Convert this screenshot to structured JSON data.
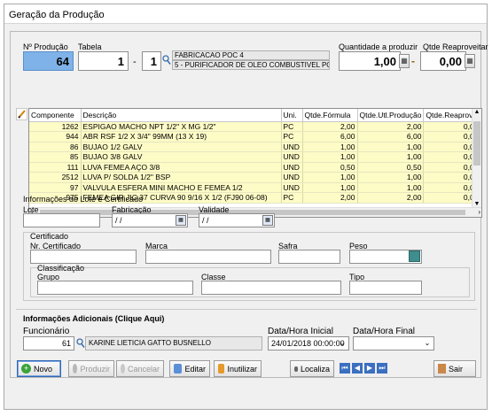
{
  "window": {
    "title": "Geração da Produção"
  },
  "header": {
    "nproducao_label": "Nº Produção",
    "nproducao_value": "64",
    "tabela_label": "Tabela",
    "tabela_value1": "1",
    "tabela_sep": "-",
    "tabela_value2": "1",
    "tabela_desc1": "FABRICACAO POC 4",
    "tabela_desc2": "5 - PURIFICADOR DE OLEO COMBUSTIVEL POC 4 UN",
    "qtd_produzir_label": "Quantidade a produzir",
    "qtd_produzir_value": "1,00",
    "qtd_reaprov_label": "Qtde Reaproveitar",
    "qtd_reaprov_value": "0,00",
    "minus_sign": "-"
  },
  "grid": {
    "columns": [
      "Componente",
      "Descrição",
      "Uni.",
      "Qtde.Fórmula",
      "Qtde.Utl.Produção",
      "Qtde.Reaprov."
    ],
    "rows": [
      {
        "comp": "1262",
        "desc": "ESPIGAO MACHO NPT 1/2\" X MG 1/2\"",
        "uni": "PC",
        "qf": "2,00",
        "qu": "2,00",
        "qr": "0,00"
      },
      {
        "comp": "944",
        "desc": "ABR RSF 1/2 X 3/4\" 99MM (13 X 19)",
        "uni": "PC",
        "qf": "6,00",
        "qu": "6,00",
        "qr": "0,00"
      },
      {
        "comp": "86",
        "desc": "BUJAO 1/2 GALV",
        "uni": "UND",
        "qf": "1,00",
        "qu": "1,00",
        "qr": "0,00"
      },
      {
        "comp": "85",
        "desc": "BUJAO 3/8 GALV",
        "uni": "UND",
        "qf": "1,00",
        "qu": "1,00",
        "qr": "0,00"
      },
      {
        "comp": "111",
        "desc": "LUVA FEMEA AÇO 3/8",
        "uni": "UND",
        "qf": "0,50",
        "qu": "0,50",
        "qr": "0,00"
      },
      {
        "comp": "2512",
        "desc": "LUVA P/ SOLDA 1/2\" BSP",
        "uni": "UND",
        "qf": "1,00",
        "qu": "1,00",
        "qr": "0,00"
      },
      {
        "comp": "97",
        "desc": "VALVULA ESFERA MINI MACHO E FEMEA 1/2",
        "uni": "UND",
        "qf": "1,00",
        "qu": "1,00",
        "qr": "0,00"
      },
      {
        "comp": "975",
        "desc": "FEMEA GIR JIC 37 CURVA 90 9/16 X 1/2 (FJ90 06-08)",
        "uni": "PC",
        "qf": "2,00",
        "qu": "2,00",
        "qr": "0,00"
      }
    ]
  },
  "lote": {
    "section_title": "Informações do Lote e Certificado",
    "lote_label": "Lote",
    "fabricacao_label": "Fabricação",
    "fabricacao_value": "/ /",
    "validade_label": "Validade",
    "validade_value": "/ /",
    "certificado_title": "Certificado",
    "nr_cert_label": "Nr. Certificado",
    "marca_label": "Marca",
    "safra_label": "Safra",
    "peso_label": "Peso",
    "classificacao_title": "Classificação",
    "grupo_label": "Grupo",
    "classe_label": "Classe",
    "tipo_label": "Tipo"
  },
  "adicionais": {
    "title": "Informações Adicionais (Clique Aqui)",
    "funcionario_label": "Funcionário",
    "funcionario_value": "61",
    "funcionario_name": "KARINE LIETICIA GATTO BUSNELLO",
    "data_inicial_label": "Data/Hora Inicial",
    "data_inicial_value": "24/01/2018 00:00:00",
    "data_final_label": "Data/Hora Final"
  },
  "toolbar": {
    "novo": "Novo",
    "produzir": "Produzir",
    "cancelar": "Cancelar",
    "editar": "Editar",
    "inutilizar": "Inutilizar",
    "localiza": "Localiza",
    "sair": "Sair"
  },
  "colors": {
    "selected_field": "#7fb2e8",
    "grid_row": "#fdfbc6"
  },
  "icons": [
    "search-icon",
    "calculator-icon",
    "calendar-icon",
    "edit-pencil-icon",
    "add-icon",
    "check-icon",
    "cancel-icon",
    "flashlight-icon",
    "first-icon",
    "prev-icon",
    "next-icon",
    "last-icon",
    "exit-icon"
  ]
}
